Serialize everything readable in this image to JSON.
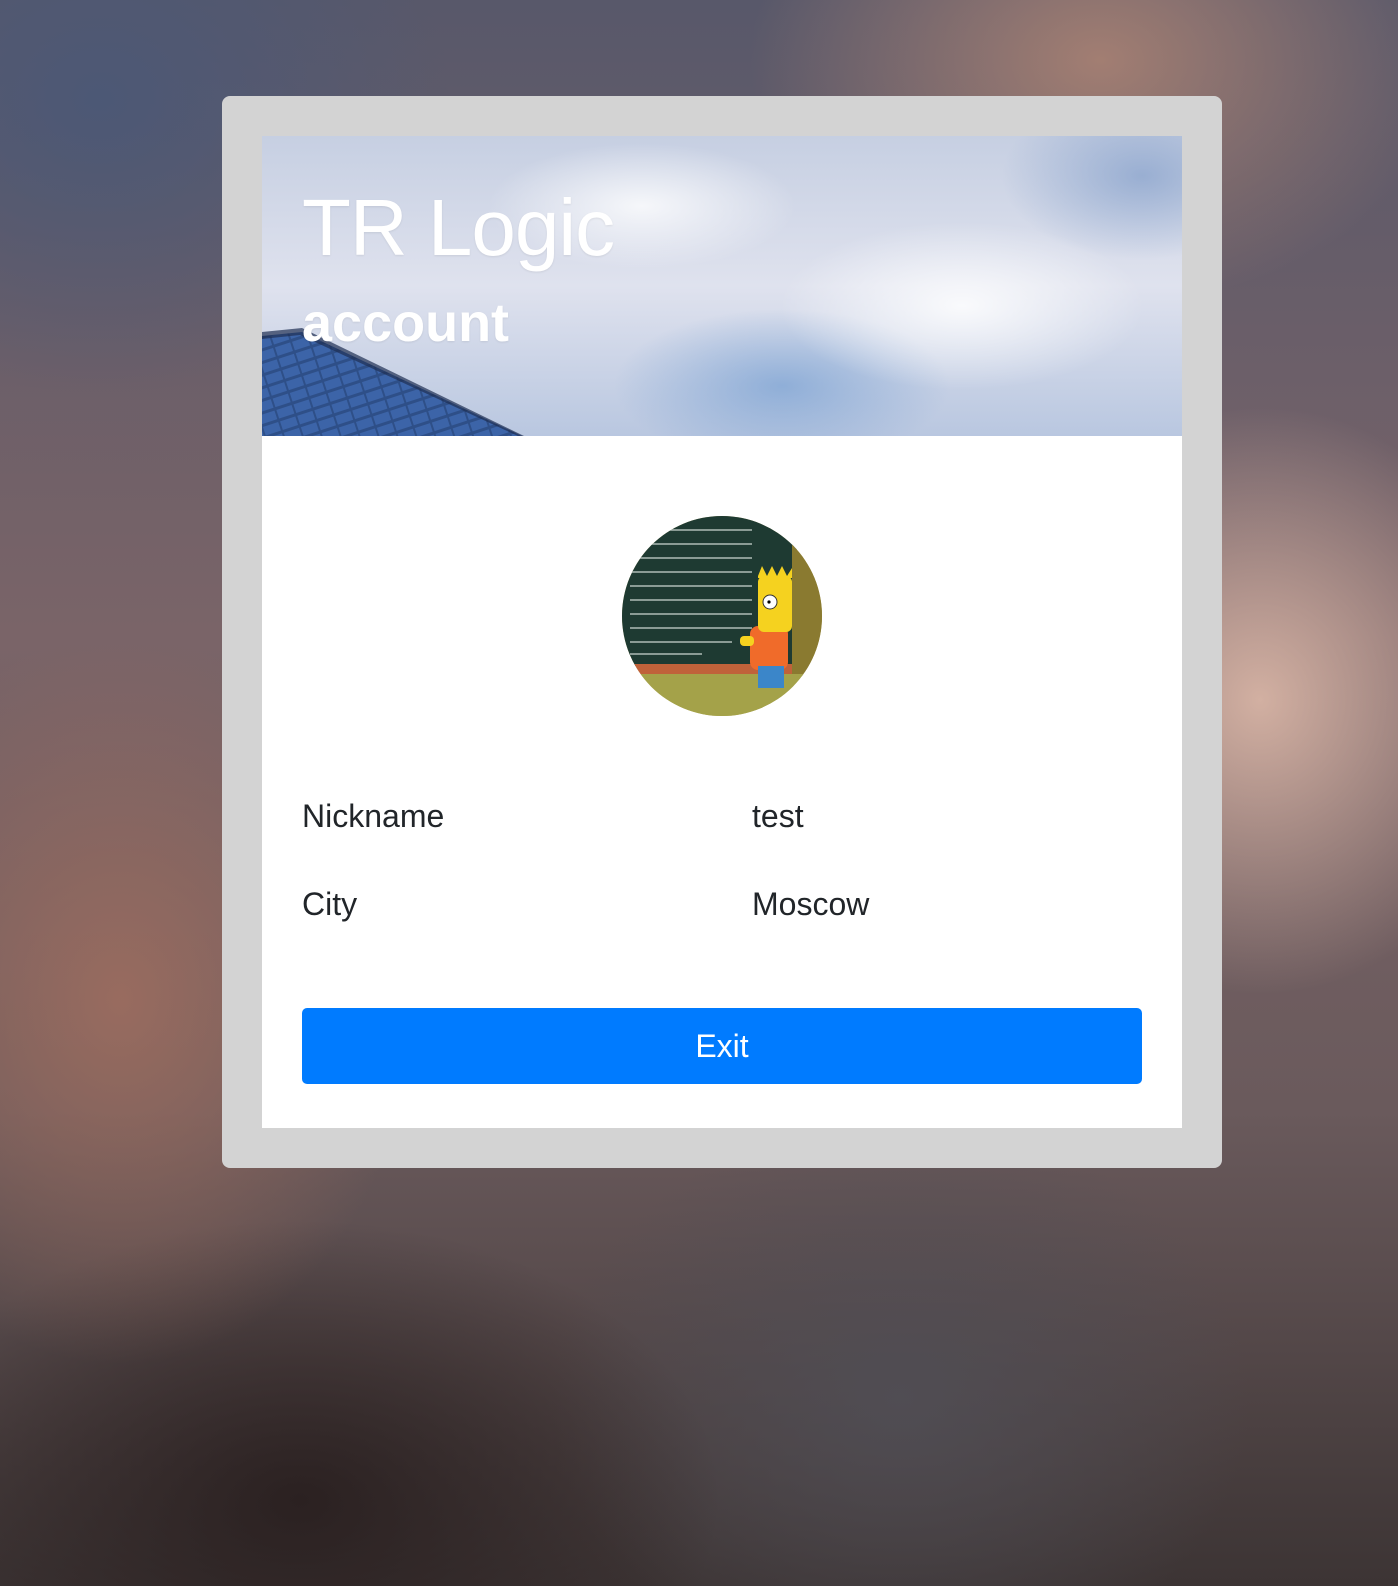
{
  "header": {
    "title": "TR Logic",
    "subtitle": "account"
  },
  "avatar": {
    "icon": "avatar-image"
  },
  "profile": {
    "rows": [
      {
        "label": "Nickname",
        "value": "test"
      },
      {
        "label": "City",
        "value": "Moscow"
      }
    ]
  },
  "actions": {
    "exit_label": "Exit"
  },
  "colors": {
    "accent": "#007bff",
    "frame": "#d3d3d3",
    "text": "#212529"
  }
}
